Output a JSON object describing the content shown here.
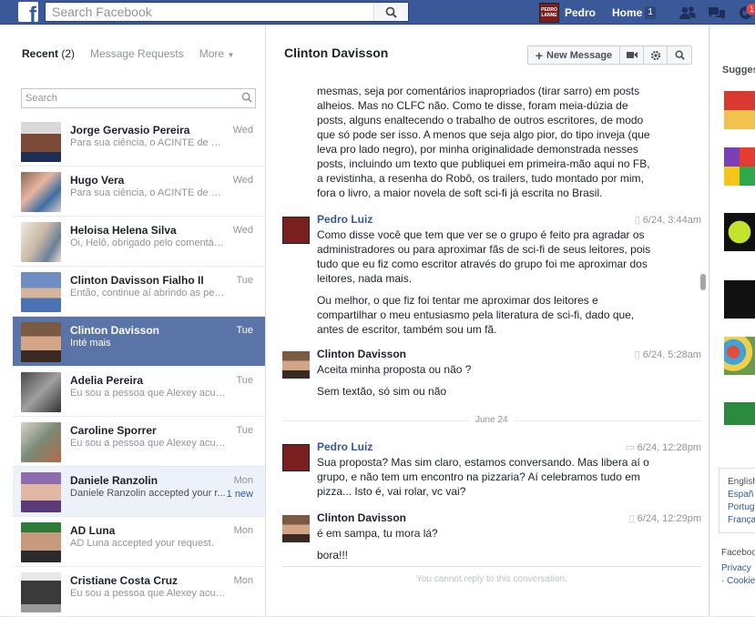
{
  "topbar": {
    "search_placeholder": "Search Facebook",
    "user_name": "Pedro",
    "home_label": "Home",
    "home_badge": "1",
    "notifications_badge": "1",
    "avatar_text": "PEDRO LANNE"
  },
  "left": {
    "tab_recent": "Recent",
    "tab_recent_count": "(2)",
    "tab_requests": "Message Requests",
    "tab_more": "More",
    "search_placeholder": "Search",
    "threads": [
      {
        "name": "Jorge Gervasio Pereira",
        "snippet": "Para sua ciência, o ACINTE de Cl...",
        "time": "Wed"
      },
      {
        "name": "Hugo Vera",
        "snippet": "Para sua ciência, o ACINTE de Cl...",
        "time": "Wed"
      },
      {
        "name": "Heloisa Helena Silva",
        "snippet": "Oi, Helô, obrigado pelo comentári...",
        "time": "Wed"
      },
      {
        "name": "Clinton Davisson Fialho II",
        "snippet": "Então, continue aí abrindo as pern...",
        "time": "Tue"
      },
      {
        "name": "Clinton Davisson",
        "snippet": "Inté mais",
        "time": "Tue"
      },
      {
        "name": "Adelia Pereira",
        "snippet": "Eu sou a pessoa que Alexey acus...",
        "time": "Tue"
      },
      {
        "name": "Caroline Sporrer",
        "snippet": "Eu sou a pessoa que Alexey acus...",
        "time": "Tue"
      },
      {
        "name": "Daniele Ranzolin",
        "snippet": "Daniele Ranzolin accepted your r...",
        "time": "Mon",
        "new": "1 new"
      },
      {
        "name": "AD Luna",
        "snippet": "AD Luna accepted your request.",
        "time": "Mon"
      },
      {
        "name": "Cristiane Costa Cruz",
        "snippet": "Eu sou a pessoa que Alexey acus...",
        "time": "Mon"
      }
    ]
  },
  "conversation": {
    "title": "Clinton Davisson",
    "new_message_label": "New Message",
    "messages": [
      {
        "lines": [
          "mesmas, seja por comentários inapropriados (tirar sarro) em posts",
          "alheios. Mas no CLFC não. Como te disse, foram meia-dúzia de",
          "posts, alguns enaltecendo o trabalho de outros escritores, de modo",
          "que só pode ser isso. A menos que seja algo pior, do tipo inveja (que",
          "leva pro lado negro), por minha originalidade demonstrada nesses",
          "posts, incluindo um texto que publiquei em primeira-mão aqui no FB,",
          "a revistinha, a resenha do Robô, os trailers, tudo montado por mim,",
          "fora o livro, a maior novela de soft sci-fi já escrita no Brasil."
        ]
      },
      {
        "author": "Pedro Luiz",
        "time": "6/24, 3:44am",
        "p1": [
          "Como disse você que tem que ver se o grupo é feito pra agradar os",
          "administradores ou para aproximar fãs de sci-fi de seus leitores, pois",
          "tudo que eu fiz como escritor através do grupo foi me aproximar dos",
          "leitores, nada mais."
        ],
        "p2": [
          "Ou melhor,  o que fiz foi tentar me aproximar dos leitores e",
          "compartilhar o meu entusiasmo pela literatura de sci-fi, dado que,",
          "antes de escritor, também sou um fã."
        ]
      },
      {
        "author": "Clinton Davisson",
        "time": "6/24, 5:28am",
        "p1": "Aceita minha proposta ou não ?",
        "p2": "Sem textão, só sim ou não"
      },
      {
        "divider": "June 24"
      },
      {
        "author": "Pedro Luiz",
        "time": "6/24, 12:28pm",
        "p1": [
          "Sua proposta? Mas sim claro, estamos conversando. Mas libera aí o",
          "grupo, e não tem um encontro na pizzaria? Aí celebramos tudo em",
          "pizza... Isto é, vai rolar, vc vai?"
        ]
      },
      {
        "author": "Clinton Davisson",
        "time": "6/24, 12:29pm",
        "p1": "é em sampa, tu mora lá?",
        "p2": "bora!!!"
      }
    ],
    "footer": "You cannot reply to this conversation."
  },
  "right": {
    "suggested": "Sugges",
    "lang_current": "English",
    "lang_1": "Españ",
    "lang_2": "Portug",
    "lang_3": "França",
    "footer_brand": "Faceboo",
    "footer_privacy": "Privacy",
    "footer_cookies": "· Cookie"
  }
}
